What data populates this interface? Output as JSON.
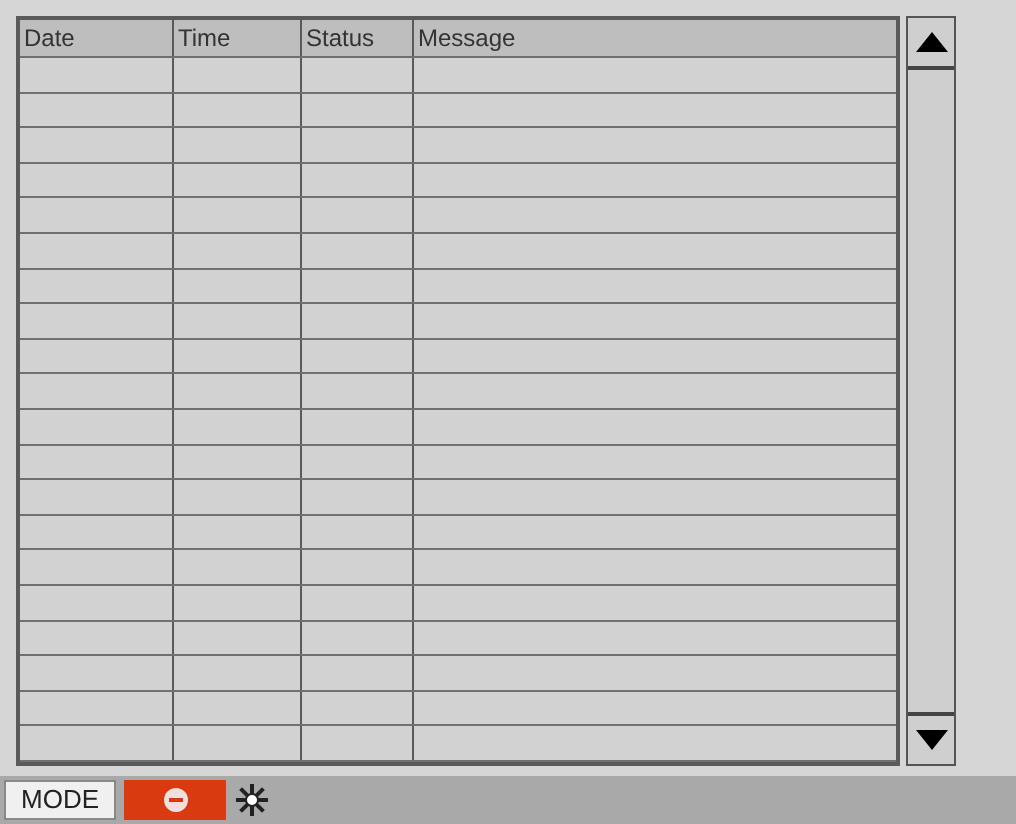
{
  "table": {
    "columns": [
      "Date",
      "Time",
      "Status",
      "Message"
    ]
  },
  "status_bar": {
    "mode_button": "MODE"
  }
}
